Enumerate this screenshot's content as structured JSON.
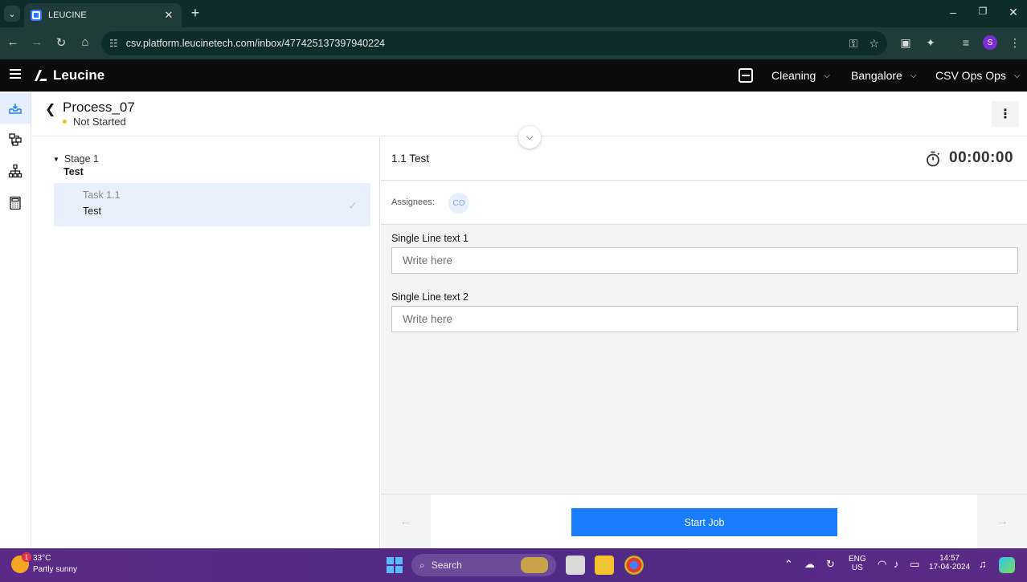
{
  "browser": {
    "tab_title": "LEUCINE",
    "url": "csv.platform.leucinetech.com/inbox/477425137397940224",
    "profile_initial": "S"
  },
  "app": {
    "logo_text": "Leucine",
    "header": {
      "facility_dropdown": "Cleaning",
      "location_dropdown": "Bangalore",
      "use_case_dropdown": "CSV Ops Ops"
    },
    "process": {
      "title": "Process_07",
      "status": "Not Started"
    },
    "stage": {
      "label": "Stage 1",
      "name": "Test",
      "task": {
        "number": "Task 1.1",
        "name": "Test"
      }
    },
    "task_panel": {
      "title": "1.1 Test",
      "timer": "00:00:00",
      "assignees_label": "Assignees:",
      "assignee_initials": "CO",
      "fields": [
        {
          "label": "Single Line text 1",
          "placeholder": "Write here"
        },
        {
          "label": "Single Line text 2",
          "placeholder": "Write here"
        }
      ],
      "primary_action": "Start Job"
    }
  },
  "taskbar": {
    "weather_temp": "33°C",
    "weather_desc": "Partly sunny",
    "weather_badge": "1",
    "search_placeholder": "Search",
    "lang_top": "ENG",
    "lang_bottom": "US",
    "time": "14:57",
    "date": "17-04-2024"
  },
  "colors": {
    "primary": "#1a7cff",
    "status_not_started": "#f1c21b",
    "selected_task_bg": "#e8f0fc"
  }
}
